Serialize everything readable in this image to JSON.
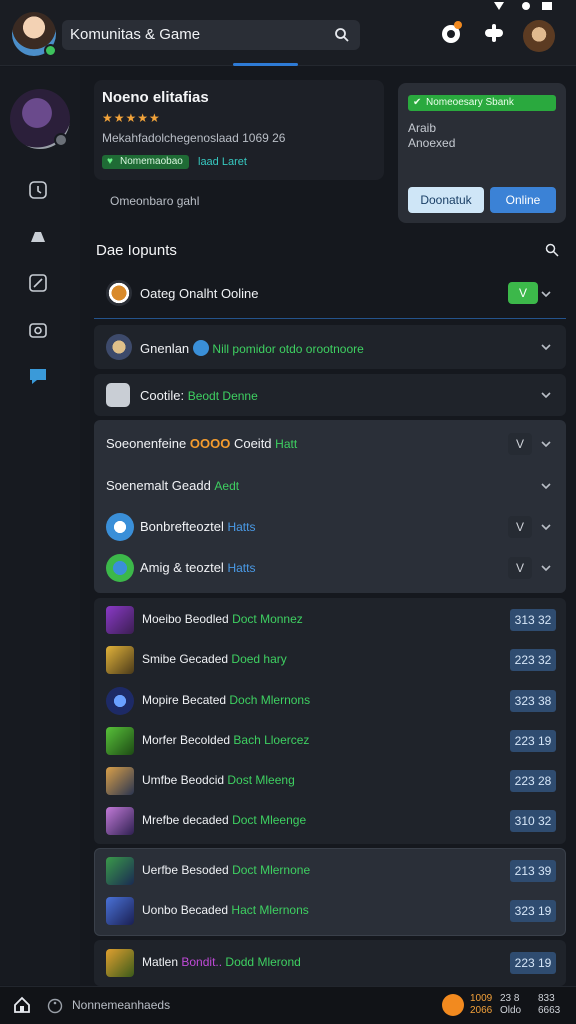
{
  "header": {
    "search_label": "Komunitas & Game"
  },
  "profile": {
    "name": "Noeno elitafias",
    "stars": "★★★★★",
    "description": "Mekahfadolchegenoslaad 1069 26",
    "pill": "Nomemaobao",
    "pill_note": "laad Laret",
    "sub_note": "Omeonbaro gahl"
  },
  "status_card": {
    "badge": "Nomeoesary Sbank",
    "line1": "Araib",
    "line2": "Anoexed",
    "button_light": "Doonatuk",
    "button_blue": "Online"
  },
  "section": {
    "title": "Dae Iopunts"
  },
  "rows": [
    {
      "text": "Oateg Onalht Ooline",
      "chip": "V"
    },
    {
      "text": "Gnenlan",
      "accent": "Nill pomidor otdo orootnoore"
    },
    {
      "text": "Cootile:",
      "accent": "Beodt Denne"
    },
    {
      "text": "Soeonenfeine",
      "orange": "OOOO",
      "rest": "Coeitd",
      "accent": "Hatt",
      "chip": "V"
    },
    {
      "text": "Soenemalt Geadd",
      "accent": "Aedt"
    },
    {
      "text": "Bonbrefteoztel",
      "accent": "Hatts",
      "chip": "V"
    },
    {
      "text": "Amig & teoztel",
      "accent": "Hatts",
      "chip": "V"
    }
  ],
  "games": [
    {
      "name": "Moeibo Beodled",
      "tag": "Doct Monnez",
      "score": "313 32"
    },
    {
      "name": "Smibe Gecaded",
      "tag": "Doed hary",
      "score": "223 32"
    },
    {
      "name": "Mopire Becated",
      "tag": "Doch Mlernons",
      "score": "323 38"
    },
    {
      "name": "Morfer Becolded",
      "tag": "Bach Lloercez",
      "score": "223 19"
    },
    {
      "name": "Umfbe Beodcid",
      "tag": "Dost Mleeng",
      "score": "223 28"
    },
    {
      "name": "Mrefbe decaded",
      "tag": "Doct Mleenge",
      "score": "310 32"
    },
    {
      "name": "Uerfbe Besoded",
      "tag": "Doct Mlernone",
      "score": "213 39"
    },
    {
      "name": "Uonbo Becaded",
      "tag": "Hact Mlernons",
      "score": "323 19"
    },
    {
      "name": "Matlen",
      "tag_purple": "Bondit..",
      "tag": "Dodd Mlerond",
      "score": "223 19"
    }
  ],
  "bottom": {
    "label": "Nonnemeanhaeds",
    "coin_top": "1009",
    "coin_bottom": "2066",
    "c2_top": "23 8",
    "c2_bottom": "Oldo",
    "c3_top": "833",
    "c3_bottom": "6663"
  },
  "colors": {
    "accent_green": "#3ed061",
    "accent_blue": "#3b82d6",
    "background": "#15181e"
  }
}
